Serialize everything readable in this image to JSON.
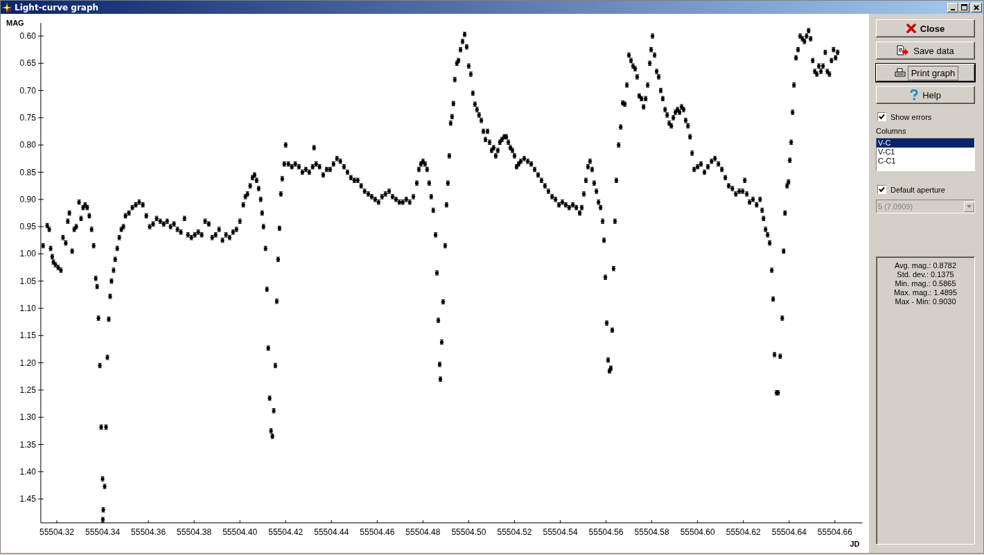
{
  "window": {
    "title": "Light-curve graph"
  },
  "chart": {
    "chart_data": {
      "type": "scatter",
      "xlabel": "JD",
      "ylabel": "MAG",
      "xlim": [
        55504.313,
        55504.672
      ],
      "ylim": [
        1.494,
        0.576
      ],
      "xticks": [
        {
          "value": 55504.32,
          "label": "55504.32"
        },
        {
          "value": 55504.34,
          "label": "55504.34"
        },
        {
          "value": 55504.36,
          "label": "55504.36"
        },
        {
          "value": 55504.38,
          "label": "55504.38"
        },
        {
          "value": 55504.4,
          "label": "55504.40"
        },
        {
          "value": 55504.42,
          "label": "55504.42"
        },
        {
          "value": 55504.44,
          "label": "55504.44"
        },
        {
          "value": 55504.46,
          "label": "55504.46"
        },
        {
          "value": 55504.48,
          "label": "55504.48"
        },
        {
          "value": 55504.5,
          "label": "55504.50"
        },
        {
          "value": 55504.52,
          "label": "55504.52"
        },
        {
          "value": 55504.54,
          "label": "55504.54"
        },
        {
          "value": 55504.56,
          "label": "55504.56"
        },
        {
          "value": 55504.58,
          "label": "55504.58"
        },
        {
          "value": 55504.6,
          "label": "55504.60"
        },
        {
          "value": 55504.62,
          "label": "55504.62"
        },
        {
          "value": 55504.64,
          "label": "55504.64"
        },
        {
          "value": 55504.66,
          "label": "55504.66"
        }
      ],
      "yticks": [
        {
          "value": 0.6,
          "label": "0.60"
        },
        {
          "value": 0.65,
          "label": "0.65"
        },
        {
          "value": 0.7,
          "label": "0.70"
        },
        {
          "value": 0.75,
          "label": "0.75"
        },
        {
          "value": 0.8,
          "label": "0.80"
        },
        {
          "value": 0.85,
          "label": "0.85"
        },
        {
          "value": 0.9,
          "label": "0.90"
        },
        {
          "value": 0.95,
          "label": "0.95"
        },
        {
          "value": 1.0,
          "label": "1.00"
        },
        {
          "value": 1.05,
          "label": "1.05"
        },
        {
          "value": 1.1,
          "label": "1.10"
        },
        {
          "value": 1.15,
          "label": "1.15"
        },
        {
          "value": 1.2,
          "label": "1.20"
        },
        {
          "value": 1.25,
          "label": "1.25"
        },
        {
          "value": 1.3,
          "label": "1.30"
        },
        {
          "value": 1.35,
          "label": "1.35"
        },
        {
          "value": 1.4,
          "label": "1.40"
        },
        {
          "value": 1.45,
          "label": "1.45"
        }
      ],
      "x": [
        55504.314,
        55504.3158,
        55504.3167,
        55504.3173,
        55504.318,
        55504.3185,
        55504.3194,
        55504.3206,
        55504.3218,
        55504.3227,
        55504.3239,
        55504.3248,
        55504.3255,
        55504.3267,
        55504.3276,
        55504.3285,
        55504.3297,
        55504.3306,
        55504.3315,
        55504.3324,
        55504.3333,
        55504.3342,
        55504.3352,
        55504.3361,
        55504.337,
        55504.3376,
        55504.3382,
        55504.3388,
        55504.3394,
        55504.34,
        55504.3403,
        55504.3401,
        55504.3409,
        55504.3415,
        55504.3421,
        55504.3427,
        55504.3433,
        55504.3439,
        55504.3448,
        55504.3455,
        55504.3464,
        55504.3473,
        55504.3482,
        55504.3491,
        55504.35,
        55504.3515,
        55504.353,
        55504.3545,
        55504.356,
        55504.3576,
        55504.3591,
        55504.3606,
        55504.3621,
        55504.3636,
        55504.3652,
        55504.3667,
        55504.3682,
        55504.3697,
        55504.3712,
        55504.3727,
        55504.3742,
        55504.3758,
        55504.3773,
        55504.3788,
        55504.3803,
        55504.3818,
        55504.3833,
        55504.3848,
        55504.3864,
        55504.3879,
        55504.3894,
        55504.3909,
        55504.3924,
        55504.3939,
        55504.3955,
        55504.397,
        55504.3985,
        55504.4,
        55504.4015,
        55504.4024,
        55504.4033,
        55504.4045,
        55504.4055,
        55504.4064,
        55504.4073,
        55504.4082,
        55504.4091,
        55504.4097,
        55504.4103,
        55504.4112,
        55504.4118,
        55504.4124,
        55504.413,
        55504.4136,
        55504.4142,
        55504.4148,
        55504.4155,
        55504.4161,
        55504.4167,
        55504.4173,
        55504.4179,
        55504.4185,
        55504.4194,
        55504.42,
        55504.4212,
        55504.4227,
        55504.4242,
        55504.4258,
        55504.4273,
        55504.4288,
        55504.4303,
        55504.4318,
        55504.4324,
        55504.4333,
        55504.4348,
        55504.4364,
        55504.4379,
        55504.4394,
        55504.4409,
        55504.4424,
        55504.4439,
        55504.4455,
        55504.447,
        55504.4485,
        55504.45,
        55504.4515,
        55504.453,
        55504.4545,
        55504.4561,
        55504.4576,
        55504.4591,
        55504.4606,
        55504.4621,
        55504.4636,
        55504.4652,
        55504.4667,
        55504.4682,
        55504.4697,
        55504.4712,
        55504.4727,
        55504.4742,
        55504.4758,
        55504.4773,
        55504.4782,
        55504.4791,
        55504.48,
        55504.4809,
        55504.4818,
        55504.4827,
        55504.4836,
        55504.4845,
        55504.4855,
        55504.4861,
        55504.4867,
        55504.4873,
        55504.4876,
        55504.4882,
        55504.4888,
        55504.4897,
        55504.4903,
        55504.4909,
        55504.4915,
        55504.4921,
        55504.4927,
        55504.4933,
        55504.4939,
        55504.4948,
        55504.4955,
        55504.4964,
        55504.4973,
        55504.4982,
        55504.4991,
        55504.5,
        55504.5009,
        55504.5018,
        55504.5027,
        55504.5036,
        55504.5045,
        55504.5055,
        55504.5064,
        55504.5073,
        55504.5082,
        55504.5091,
        55504.51,
        55504.5109,
        55504.5118,
        55504.5127,
        55504.5136,
        55504.5145,
        55504.5155,
        55504.5164,
        55504.5173,
        55504.5182,
        55504.5191,
        55504.52,
        55504.5209,
        55504.5218,
        55504.5227,
        55504.5242,
        55504.5258,
        55504.5273,
        55504.5288,
        55504.5303,
        55504.5318,
        55504.5333,
        55504.5348,
        55504.5364,
        55504.5379,
        55504.5394,
        55504.5409,
        55504.5424,
        55504.5439,
        55504.5455,
        55504.547,
        55504.5485,
        55504.5494,
        55504.5503,
        55504.5512,
        55504.5521,
        55504.553,
        55504.5539,
        55504.5548,
        55504.5558,
        55504.5567,
        55504.5576,
        55504.5585,
        55504.5591,
        55504.5597,
        55504.5603,
        55504.5609,
        55504.5615,
        55504.5621,
        55504.5627,
        55504.5633,
        55504.5639,
        55504.5645,
        55504.5655,
        55504.5664,
        55504.5673,
        55504.5682,
        55504.5691,
        55504.57,
        55504.5709,
        55504.5718,
        55504.5727,
        55504.5736,
        55504.5745,
        55504.5755,
        55504.5764,
        55504.5773,
        55504.5782,
        55504.5791,
        55504.5797,
        55504.5803,
        55504.5812,
        55504.5821,
        55504.583,
        55504.5839,
        55504.5848,
        55504.5858,
        55504.5867,
        55504.5876,
        55504.5885,
        55504.5894,
        55504.5903,
        55504.5912,
        55504.5921,
        55504.593,
        55504.5939,
        55504.5948,
        55504.5958,
        55504.5967,
        55504.5976,
        55504.5985,
        55504.6,
        55504.6015,
        55504.603,
        55504.6045,
        55504.6061,
        55504.6076,
        55504.6091,
        55504.6106,
        55504.6121,
        55504.6136,
        55504.6152,
        55504.6167,
        55504.6182,
        55504.6197,
        55504.6206,
        55504.6215,
        55504.6227,
        55504.6242,
        55504.6258,
        55504.6273,
        55504.6282,
        55504.6288,
        55504.6297,
        55504.6306,
        55504.6315,
        55504.6324,
        55504.633,
        55504.6336,
        55504.6345,
        55504.6352,
        55504.6361,
        55504.637,
        55504.6376,
        55504.6382,
        55504.6391,
        55504.6397,
        55504.6403,
        55504.6409,
        55504.6415,
        55504.6421,
        55504.643,
        55504.6439,
        55504.6448,
        55504.6458,
        55504.6467,
        55504.6476,
        55504.6485,
        55504.6494,
        55504.6503,
        55504.6512,
        55504.6521,
        55504.653,
        55504.6539,
        55504.6548,
        55504.6558,
        55504.6567,
        55504.6576,
        55504.6585,
        55504.6594,
        55504.6603,
        55504.6612
      ],
      "series": [
        {
          "color": "#000000",
          "values": [
            0.985,
            0.948,
            0.955,
            0.99,
            1.005,
            1.015,
            1.02,
            1.025,
            1.03,
            0.97,
            0.98,
            0.94,
            0.925,
            0.995,
            0.955,
            0.95,
            0.905,
            0.935,
            0.915,
            0.91,
            0.915,
            0.93,
            0.955,
            0.985,
            1.045,
            1.06,
            1.118,
            1.205,
            1.318,
            1.413,
            1.47,
            1.488,
            1.427,
            1.318,
            1.19,
            1.12,
            1.078,
            1.05,
            1.03,
            1.01,
            0.99,
            0.97,
            0.955,
            0.95,
            0.93,
            0.925,
            0.915,
            0.91,
            0.905,
            0.91,
            0.93,
            0.95,
            0.945,
            0.935,
            0.94,
            0.945,
            0.94,
            0.95,
            0.945,
            0.955,
            0.96,
            0.935,
            0.965,
            0.97,
            0.965,
            0.96,
            0.965,
            0.94,
            0.945,
            0.97,
            0.965,
            0.955,
            0.975,
            0.965,
            0.97,
            0.96,
            0.955,
            0.94,
            0.91,
            0.895,
            0.89,
            0.875,
            0.86,
            0.855,
            0.865,
            0.88,
            0.9,
            0.925,
            0.95,
            0.99,
            1.065,
            1.173,
            1.265,
            1.325,
            1.335,
            1.288,
            1.205,
            1.087,
            1.01,
            0.953,
            0.89,
            0.862,
            0.835,
            0.8,
            0.835,
            0.84,
            0.835,
            0.84,
            0.85,
            0.845,
            0.85,
            0.84,
            0.805,
            0.835,
            0.84,
            0.855,
            0.845,
            0.845,
            0.835,
            0.825,
            0.83,
            0.84,
            0.85,
            0.86,
            0.865,
            0.865,
            0.875,
            0.885,
            0.89,
            0.895,
            0.9,
            0.905,
            0.895,
            0.89,
            0.885,
            0.895,
            0.9,
            0.905,
            0.905,
            0.9,
            0.905,
            0.895,
            0.87,
            0.845,
            0.835,
            0.83,
            0.835,
            0.845,
            0.87,
            0.895,
            0.92,
            0.965,
            1.035,
            1.122,
            1.203,
            1.23,
            1.162,
            1.088,
            0.985,
            0.91,
            0.87,
            0.82,
            0.76,
            0.748,
            0.724,
            0.68,
            0.65,
            0.645,
            0.625,
            0.61,
            0.597,
            0.62,
            0.655,
            0.67,
            0.705,
            0.725,
            0.735,
            0.745,
            0.755,
            0.775,
            0.79,
            0.775,
            0.795,
            0.81,
            0.805,
            0.82,
            0.81,
            0.795,
            0.79,
            0.785,
            0.785,
            0.795,
            0.805,
            0.81,
            0.82,
            0.84,
            0.835,
            0.83,
            0.825,
            0.83,
            0.835,
            0.845,
            0.855,
            0.865,
            0.875,
            0.885,
            0.895,
            0.9,
            0.91,
            0.905,
            0.91,
            0.915,
            0.91,
            0.915,
            0.925,
            0.915,
            0.89,
            0.865,
            0.84,
            0.83,
            0.845,
            0.87,
            0.885,
            0.905,
            0.915,
            0.94,
            0.975,
            1.043,
            1.127,
            1.195,
            1.215,
            1.21,
            1.14,
            1.027,
            0.94,
            0.865,
            0.8,
            0.767,
            0.723,
            0.725,
            0.69,
            0.635,
            0.645,
            0.655,
            0.66,
            0.675,
            0.71,
            0.715,
            0.73,
            0.715,
            0.69,
            0.65,
            0.625,
            0.6,
            0.635,
            0.665,
            0.675,
            0.7,
            0.715,
            0.735,
            0.745,
            0.76,
            0.765,
            0.75,
            0.74,
            0.735,
            0.74,
            0.73,
            0.735,
            0.755,
            0.765,
            0.785,
            0.815,
            0.845,
            0.84,
            0.835,
            0.85,
            0.84,
            0.83,
            0.825,
            0.835,
            0.845,
            0.86,
            0.875,
            0.88,
            0.89,
            0.885,
            0.885,
            0.865,
            0.89,
            0.905,
            0.9,
            0.91,
            0.9,
            0.92,
            0.935,
            0.955,
            0.965,
            0.98,
            1.03,
            1.083,
            1.185,
            1.255,
            1.255,
            1.188,
            1.118,
            0.995,
            0.925,
            0.875,
            0.868,
            0.828,
            0.795,
            0.74,
            0.69,
            0.64,
            0.625,
            0.6,
            0.605,
            0.61,
            0.6,
            0.59,
            0.605,
            0.645,
            0.665,
            0.67,
            0.655,
            0.665,
            0.655,
            0.63,
            0.665,
            0.67,
            0.645,
            0.625,
            0.64,
            0.63
          ]
        }
      ]
    }
  },
  "panel": {
    "buttons": [
      {
        "kind": "close",
        "label": "Close",
        "focused": false
      },
      {
        "kind": "save",
        "label": "Save data",
        "focused": false
      },
      {
        "kind": "print",
        "label": "Print graph",
        "focused": true
      },
      {
        "kind": "help",
        "label": "Help",
        "focused": false
      }
    ],
    "show_errors": {
      "label": "Show errors",
      "checked": true
    },
    "columns": {
      "label": "Columns",
      "items": [
        {
          "label": "V-C",
          "selected": true
        },
        {
          "label": "V-C1",
          "selected": false
        },
        {
          "label": "C-C1",
          "selected": false
        }
      ]
    },
    "default_aperture": {
      "label": "Default aperture",
      "checked": true
    },
    "aperture_select": {
      "value": "5 (7.0909)",
      "disabled": true
    },
    "stats": [
      "Avg. mag.: 0.8782",
      "Std. dev.: 0.1375",
      "Min. mag.: 0.5865",
      "Max. mag.: 1.4895",
      "Max - Min: 0.9030"
    ]
  }
}
